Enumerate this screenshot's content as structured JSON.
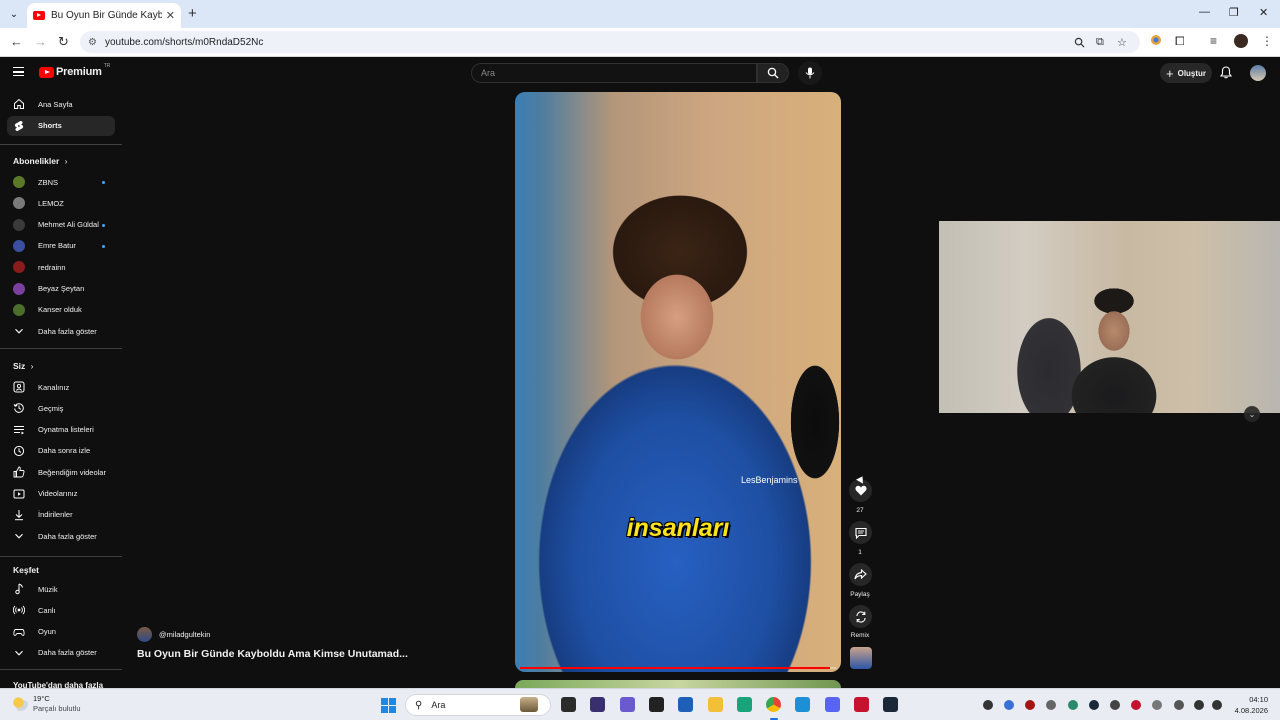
{
  "browser": {
    "tab_title": "Bu Oyun Bir Günde Kayboldu A",
    "url": "youtube.com/shorts/m0RndaD52Nc"
  },
  "masthead": {
    "logo_text": "Premium",
    "logo_sup": "TR",
    "search_placeholder": "Ara",
    "create_label": "Oluştur"
  },
  "sidebar": {
    "main": [
      {
        "label": "Ana Sayfa",
        "icon": "home-icon"
      },
      {
        "label": "Shorts",
        "icon": "shorts-icon",
        "active": true
      }
    ],
    "subscriptions_title": "Abonelikler",
    "subscriptions": [
      {
        "label": "ZBNS",
        "dot": true,
        "color": "#5a7a2a"
      },
      {
        "label": "LEMOZ",
        "dot": false,
        "color": "#7a7a7a"
      },
      {
        "label": "Mehmet Ali Güldal",
        "dot": true,
        "color": "#3a3a3a"
      },
      {
        "label": "Emre Batur",
        "dot": true,
        "color": "#3a4fa0"
      },
      {
        "label": "redrainn",
        "dot": false,
        "color": "#8a1c1c"
      },
      {
        "label": "Beyaz Şeytan",
        "dot": false,
        "color": "#7b3fa0"
      },
      {
        "label": "Kanser olduk",
        "dot": false,
        "color": "#4b6e2a"
      }
    ],
    "show_more": "Daha fazla göster",
    "you_title": "Siz",
    "you_items": [
      {
        "label": "Kanalınız",
        "icon": "channel-icon"
      },
      {
        "label": "Geçmiş",
        "icon": "history-icon"
      },
      {
        "label": "Oynatma listeleri",
        "icon": "playlist-icon"
      },
      {
        "label": "Daha sonra izle",
        "icon": "watch-later-icon"
      },
      {
        "label": "Beğendiğim videolar",
        "icon": "liked-icon"
      },
      {
        "label": "Videolarınız",
        "icon": "your-videos-icon"
      },
      {
        "label": "İndirilenler",
        "icon": "download-icon"
      },
      {
        "label": "Daha fazla göster",
        "icon": "chevron-down-icon"
      }
    ],
    "explore_title": "Keşfet",
    "explore_items": [
      {
        "label": "Müzik",
        "icon": "music-icon"
      },
      {
        "label": "Canlı",
        "icon": "live-icon"
      },
      {
        "label": "Oyun",
        "icon": "gaming-icon"
      },
      {
        "label": "Daha fazla göster",
        "icon": "chevron-down-icon"
      }
    ],
    "footer_title": "YouTube'dan daha fazla"
  },
  "short": {
    "caption": "insanları",
    "brand_text": "LesBenjamins",
    "author": "@miladgultekin",
    "title": "Bu Oyun Bir Günde Kayboldu Ama Kimse Unutamad...",
    "progress": 0.98,
    "actions": {
      "likes": "27",
      "comments": "1",
      "share": "Paylaş",
      "remix": "Remix"
    }
  },
  "taskbar": {
    "weather_temp": "19°C",
    "weather_desc": "Parçalı bulutlu",
    "search_label": "Ara",
    "time": "04:10",
    "date": "4.08.2026"
  }
}
